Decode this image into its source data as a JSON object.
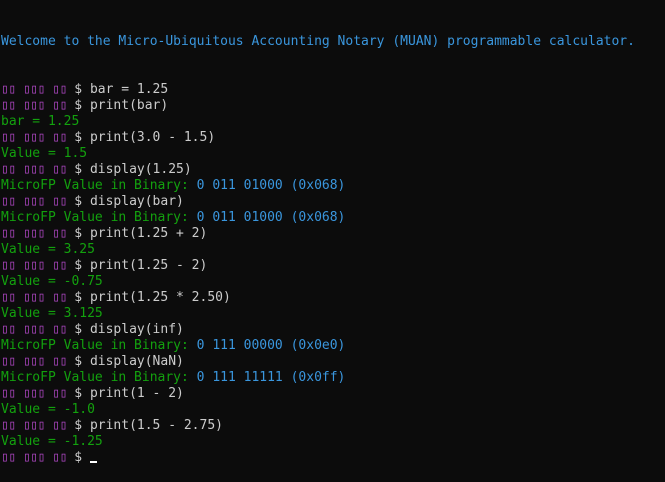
{
  "banner": "Welcome to the Micro-Ubiquitous Accounting Notary (MUAN) programmable calculator.",
  "prompt": {
    "glyphs": "▯▯ ▯▯▯ ▯▯ ",
    "dollar": "$"
  },
  "lines": [
    {
      "kind": "prompt",
      "command": "bar = 1.25"
    },
    {
      "kind": "prompt",
      "command": "print(bar)"
    },
    {
      "kind": "output",
      "label": "bar = 1.25",
      "value": ""
    },
    {
      "kind": "prompt",
      "command": "print(3.0 - 1.5)"
    },
    {
      "kind": "output",
      "label": "Value = 1.5",
      "value": ""
    },
    {
      "kind": "prompt",
      "command": "display(1.25)"
    },
    {
      "kind": "binary",
      "label": "MicroFP Value in Binary:",
      "value": " 0 011 01000 (0x068)"
    },
    {
      "kind": "prompt",
      "command": "display(bar)"
    },
    {
      "kind": "binary",
      "label": "MicroFP Value in Binary:",
      "value": " 0 011 01000 (0x068)"
    },
    {
      "kind": "prompt",
      "command": "print(1.25 + 2)"
    },
    {
      "kind": "output",
      "label": "Value = 3.25",
      "value": ""
    },
    {
      "kind": "prompt",
      "command": "print(1.25 - 2)"
    },
    {
      "kind": "output",
      "label": "Value = -0.75",
      "value": ""
    },
    {
      "kind": "prompt",
      "command": "print(1.25 * 2.50)"
    },
    {
      "kind": "output",
      "label": "Value = 3.125",
      "value": ""
    },
    {
      "kind": "prompt",
      "command": "display(inf)"
    },
    {
      "kind": "binary",
      "label": "MicroFP Value in Binary:",
      "value": " 0 111 00000 (0x0e0)"
    },
    {
      "kind": "prompt",
      "command": "display(NaN)"
    },
    {
      "kind": "binary",
      "label": "MicroFP Value in Binary:",
      "value": " 0 111 11111 (0x0ff)"
    },
    {
      "kind": "prompt",
      "command": "print(1 - 2)"
    },
    {
      "kind": "output",
      "label": "Value = -1.0",
      "value": ""
    },
    {
      "kind": "prompt",
      "command": "print(1.5 - 2.75)"
    },
    {
      "kind": "output",
      "label": "Value = -1.25",
      "value": ""
    },
    {
      "kind": "prompt-active",
      "command": ""
    }
  ],
  "colors": {
    "background": "#0c0c0c",
    "prompt_glyphs": "#b148c6",
    "output_green": "#13a10e",
    "binary_cyan": "#3a96dd",
    "text": "#cccccc"
  }
}
